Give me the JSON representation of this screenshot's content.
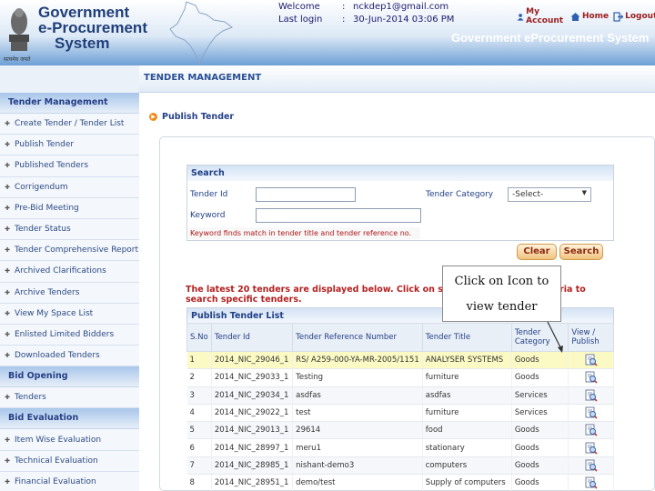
{
  "header": {
    "logo_line1": "Government",
    "logo_line2": "e-Procurement",
    "logo_line3": "System",
    "emblem_caption": "सत्यमेव जयते",
    "welcome_label": "Welcome",
    "welcome_value": "nckdep1@gmail.com",
    "lastlogin_label": "Last login",
    "lastlogin_value": "30-Jun-2014 03:06 PM",
    "separator": ":",
    "my_account": "My Account",
    "home": "Home",
    "logout": "Logout",
    "system_title": "Government eProcurement System"
  },
  "breadcrumb": "TENDER MANAGEMENT",
  "sidebar": {
    "sections": [
      {
        "title": "Tender Management",
        "items": [
          "Create Tender / Tender List",
          "Publish Tender",
          "Published Tenders",
          "Corrigendum",
          "Pre-Bid Meeting",
          "Tender Status",
          "Tender Comprehensive Report",
          "Archived Clarifications",
          "Archive Tenders",
          "View My Space List",
          "Enlisted Limited Bidders",
          "Downloaded Tenders"
        ]
      },
      {
        "title": "Bid Opening",
        "items": [
          "Tenders"
        ]
      },
      {
        "title": "Bid Evaluation",
        "items": [
          "Item Wise Evaluation",
          "Technical Evaluation",
          "Financial Evaluation"
        ]
      }
    ]
  },
  "page_title": "Publish Tender",
  "search": {
    "title": "Search",
    "tender_id_label": "Tender Id",
    "keyword_label": "Keyword",
    "category_label": "Tender Category",
    "category_value": "-Select-",
    "note": "Keyword finds match in tender title and tender reference no.",
    "clear": "Clear",
    "search": "Search"
  },
  "latest_note": "The latest 20 tenders are displayed below. Click on search with specific criteria to search specific tenders.",
  "callout": {
    "line1": "Click on Icon to",
    "line2": "view tender"
  },
  "table": {
    "title": "Publish Tender List",
    "columns": [
      "S.No",
      "Tender Id",
      "Tender Reference Number",
      "Tender Title",
      "Tender Category",
      "View / Publish"
    ],
    "rows": [
      {
        "sno": "1",
        "id": "2014_NIC_29046_1",
        "ref": "RS/ A259-000-YA-MR-2005/1151",
        "title": "ANALYSER SYSTEMS",
        "cat": "Goods",
        "highlight": true
      },
      {
        "sno": "2",
        "id": "2014_NIC_29033_1",
        "ref": "Testing",
        "title": "furniture",
        "cat": "Goods"
      },
      {
        "sno": "3",
        "id": "2014_NIC_29034_1",
        "ref": "asdfas",
        "title": "asdfas",
        "cat": "Services"
      },
      {
        "sno": "4",
        "id": "2014_NIC_29022_1",
        "ref": "test",
        "title": "furniture",
        "cat": "Services"
      },
      {
        "sno": "5",
        "id": "2014_NIC_29013_1",
        "ref": "29614",
        "title": "food",
        "cat": "Goods"
      },
      {
        "sno": "6",
        "id": "2014_NIC_28997_1",
        "ref": "meru1",
        "title": "stationary",
        "cat": "Goods"
      },
      {
        "sno": "7",
        "id": "2014_NIC_28985_1",
        "ref": "nishant-demo3",
        "title": "computers",
        "cat": "Goods"
      },
      {
        "sno": "8",
        "id": "2014_NIC_28951_1",
        "ref": "demo/test",
        "title": "Supply of computers",
        "cat": "Goods"
      }
    ]
  },
  "colors": {
    "brand_blue": "#1f3f7a",
    "alert_red": "#b42020",
    "accent_orange": "#f08b1d"
  }
}
